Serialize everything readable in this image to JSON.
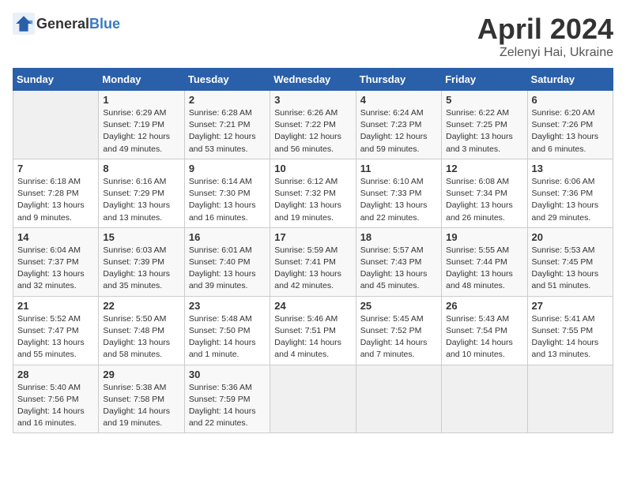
{
  "header": {
    "logo_general": "General",
    "logo_blue": "Blue",
    "title": "April 2024",
    "subtitle": "Zelenyi Hai, Ukraine"
  },
  "weekdays": [
    "Sunday",
    "Monday",
    "Tuesday",
    "Wednesday",
    "Thursday",
    "Friday",
    "Saturday"
  ],
  "weeks": [
    [
      {
        "num": "",
        "info": ""
      },
      {
        "num": "1",
        "info": "Sunrise: 6:29 AM\nSunset: 7:19 PM\nDaylight: 12 hours\nand 49 minutes."
      },
      {
        "num": "2",
        "info": "Sunrise: 6:28 AM\nSunset: 7:21 PM\nDaylight: 12 hours\nand 53 minutes."
      },
      {
        "num": "3",
        "info": "Sunrise: 6:26 AM\nSunset: 7:22 PM\nDaylight: 12 hours\nand 56 minutes."
      },
      {
        "num": "4",
        "info": "Sunrise: 6:24 AM\nSunset: 7:23 PM\nDaylight: 12 hours\nand 59 minutes."
      },
      {
        "num": "5",
        "info": "Sunrise: 6:22 AM\nSunset: 7:25 PM\nDaylight: 13 hours\nand 3 minutes."
      },
      {
        "num": "6",
        "info": "Sunrise: 6:20 AM\nSunset: 7:26 PM\nDaylight: 13 hours\nand 6 minutes."
      }
    ],
    [
      {
        "num": "7",
        "info": "Sunrise: 6:18 AM\nSunset: 7:28 PM\nDaylight: 13 hours\nand 9 minutes."
      },
      {
        "num": "8",
        "info": "Sunrise: 6:16 AM\nSunset: 7:29 PM\nDaylight: 13 hours\nand 13 minutes."
      },
      {
        "num": "9",
        "info": "Sunrise: 6:14 AM\nSunset: 7:30 PM\nDaylight: 13 hours\nand 16 minutes."
      },
      {
        "num": "10",
        "info": "Sunrise: 6:12 AM\nSunset: 7:32 PM\nDaylight: 13 hours\nand 19 minutes."
      },
      {
        "num": "11",
        "info": "Sunrise: 6:10 AM\nSunset: 7:33 PM\nDaylight: 13 hours\nand 22 minutes."
      },
      {
        "num": "12",
        "info": "Sunrise: 6:08 AM\nSunset: 7:34 PM\nDaylight: 13 hours\nand 26 minutes."
      },
      {
        "num": "13",
        "info": "Sunrise: 6:06 AM\nSunset: 7:36 PM\nDaylight: 13 hours\nand 29 minutes."
      }
    ],
    [
      {
        "num": "14",
        "info": "Sunrise: 6:04 AM\nSunset: 7:37 PM\nDaylight: 13 hours\nand 32 minutes."
      },
      {
        "num": "15",
        "info": "Sunrise: 6:03 AM\nSunset: 7:39 PM\nDaylight: 13 hours\nand 35 minutes."
      },
      {
        "num": "16",
        "info": "Sunrise: 6:01 AM\nSunset: 7:40 PM\nDaylight: 13 hours\nand 39 minutes."
      },
      {
        "num": "17",
        "info": "Sunrise: 5:59 AM\nSunset: 7:41 PM\nDaylight: 13 hours\nand 42 minutes."
      },
      {
        "num": "18",
        "info": "Sunrise: 5:57 AM\nSunset: 7:43 PM\nDaylight: 13 hours\nand 45 minutes."
      },
      {
        "num": "19",
        "info": "Sunrise: 5:55 AM\nSunset: 7:44 PM\nDaylight: 13 hours\nand 48 minutes."
      },
      {
        "num": "20",
        "info": "Sunrise: 5:53 AM\nSunset: 7:45 PM\nDaylight: 13 hours\nand 51 minutes."
      }
    ],
    [
      {
        "num": "21",
        "info": "Sunrise: 5:52 AM\nSunset: 7:47 PM\nDaylight: 13 hours\nand 55 minutes."
      },
      {
        "num": "22",
        "info": "Sunrise: 5:50 AM\nSunset: 7:48 PM\nDaylight: 13 hours\nand 58 minutes."
      },
      {
        "num": "23",
        "info": "Sunrise: 5:48 AM\nSunset: 7:50 PM\nDaylight: 14 hours\nand 1 minute."
      },
      {
        "num": "24",
        "info": "Sunrise: 5:46 AM\nSunset: 7:51 PM\nDaylight: 14 hours\nand 4 minutes."
      },
      {
        "num": "25",
        "info": "Sunrise: 5:45 AM\nSunset: 7:52 PM\nDaylight: 14 hours\nand 7 minutes."
      },
      {
        "num": "26",
        "info": "Sunrise: 5:43 AM\nSunset: 7:54 PM\nDaylight: 14 hours\nand 10 minutes."
      },
      {
        "num": "27",
        "info": "Sunrise: 5:41 AM\nSunset: 7:55 PM\nDaylight: 14 hours\nand 13 minutes."
      }
    ],
    [
      {
        "num": "28",
        "info": "Sunrise: 5:40 AM\nSunset: 7:56 PM\nDaylight: 14 hours\nand 16 minutes."
      },
      {
        "num": "29",
        "info": "Sunrise: 5:38 AM\nSunset: 7:58 PM\nDaylight: 14 hours\nand 19 minutes."
      },
      {
        "num": "30",
        "info": "Sunrise: 5:36 AM\nSunset: 7:59 PM\nDaylight: 14 hours\nand 22 minutes."
      },
      {
        "num": "",
        "info": ""
      },
      {
        "num": "",
        "info": ""
      },
      {
        "num": "",
        "info": ""
      },
      {
        "num": "",
        "info": ""
      }
    ]
  ]
}
